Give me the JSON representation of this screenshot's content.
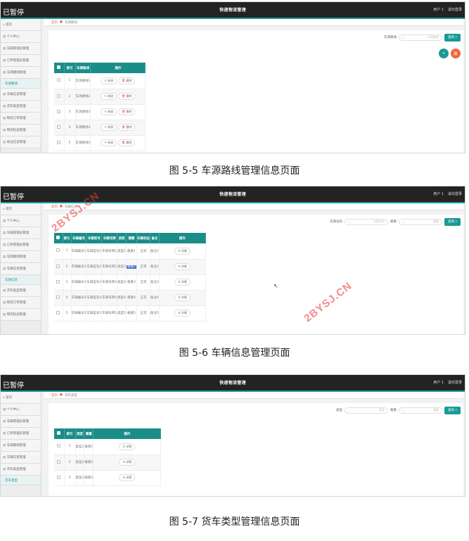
{
  "app": {
    "title": "快递物流管理",
    "paused": "已暂停",
    "user": "用户 1",
    "logout": "退出登录"
  },
  "sidebar": {
    "home": "首页",
    "personal": "个人中心",
    "menus": [
      "车辆管理员管理",
      "订单管理员管理",
      "车源路线管理",
      "车辆信息管理",
      "货车类型管理",
      "物流订单管理",
      "物流轨迹管理",
      "地址信息管理"
    ],
    "sub_route": "车源路线",
    "sub_vehicle": "车辆信息",
    "sub_type": "货车类型"
  },
  "screens": [
    {
      "breadcrumb_home": "首页",
      "breadcrumb": "车源路线",
      "search_label": "车源路线",
      "search_placeholder": "车源路线",
      "query": "查询",
      "add": "+",
      "delete": "删",
      "headers": [
        "",
        "索引",
        "车源路线",
        "操作"
      ],
      "rows": [
        [
          "1",
          "车源路线1"
        ],
        [
          "2",
          "车源路线2"
        ],
        [
          "3",
          "车源路线3"
        ],
        [
          "4",
          "车源路线4"
        ],
        [
          "5",
          "车源路线5"
        ]
      ],
      "edit": "修改",
      "remove": "删除",
      "caption": "图 5-5 车源路线管理信息页面"
    },
    {
      "breadcrumb_home": "首页",
      "breadcrumb": "车辆信息",
      "search_label1": "车辆号码",
      "search_placeholder1": "车辆号码",
      "search_label2": "载重",
      "search_placeholder2": "载重",
      "query": "查询",
      "headers": [
        "",
        "索引",
        "车辆编号",
        "车辆型号",
        "车辆号牌",
        "类型",
        "载重",
        "车辆状态",
        "备注",
        "操作"
      ],
      "rows": [
        [
          "1",
          "车辆编号1",
          "车辆型号1",
          "车辆号牌1",
          "类型1",
          "载重1",
          "正常",
          "备注1"
        ],
        [
          "2",
          "车辆编号2",
          "车辆型号2",
          "车辆号牌2",
          "类型2",
          "载重2",
          "正常",
          "备注2"
        ],
        [
          "3",
          "车辆编号3",
          "车辆型号3",
          "车辆号牌3",
          "类型3",
          "载重3",
          "正常",
          "备注3"
        ],
        [
          "4",
          "车辆编号4",
          "车辆型号4",
          "车辆号牌4",
          "类型4",
          "载重4",
          "正常",
          "备注4"
        ],
        [
          "5",
          "车辆编号5",
          "车辆型号5",
          "车辆号牌5",
          "类型5",
          "载重5",
          "正常",
          "备注5"
        ]
      ],
      "detail": "详情",
      "caption": "图 5-6 车辆信息管理页面",
      "watermark": "2BYSJ.CN"
    },
    {
      "breadcrumb_home": "首页",
      "breadcrumb": "货车类型",
      "search_label1": "类型",
      "search_placeholder1": "类型",
      "search_label2": "载重",
      "search_placeholder2": "载重",
      "query": "查询",
      "headers": [
        "",
        "索引",
        "类型",
        "载重",
        "操作"
      ],
      "rows": [
        [
          "1",
          "类型1",
          "载重1"
        ],
        [
          "2",
          "类型2",
          "载重2"
        ],
        [
          "3",
          "类型3",
          "载重3"
        ]
      ],
      "detail": "详情",
      "caption": "图 5-7 货车类型管理信息页面"
    }
  ]
}
